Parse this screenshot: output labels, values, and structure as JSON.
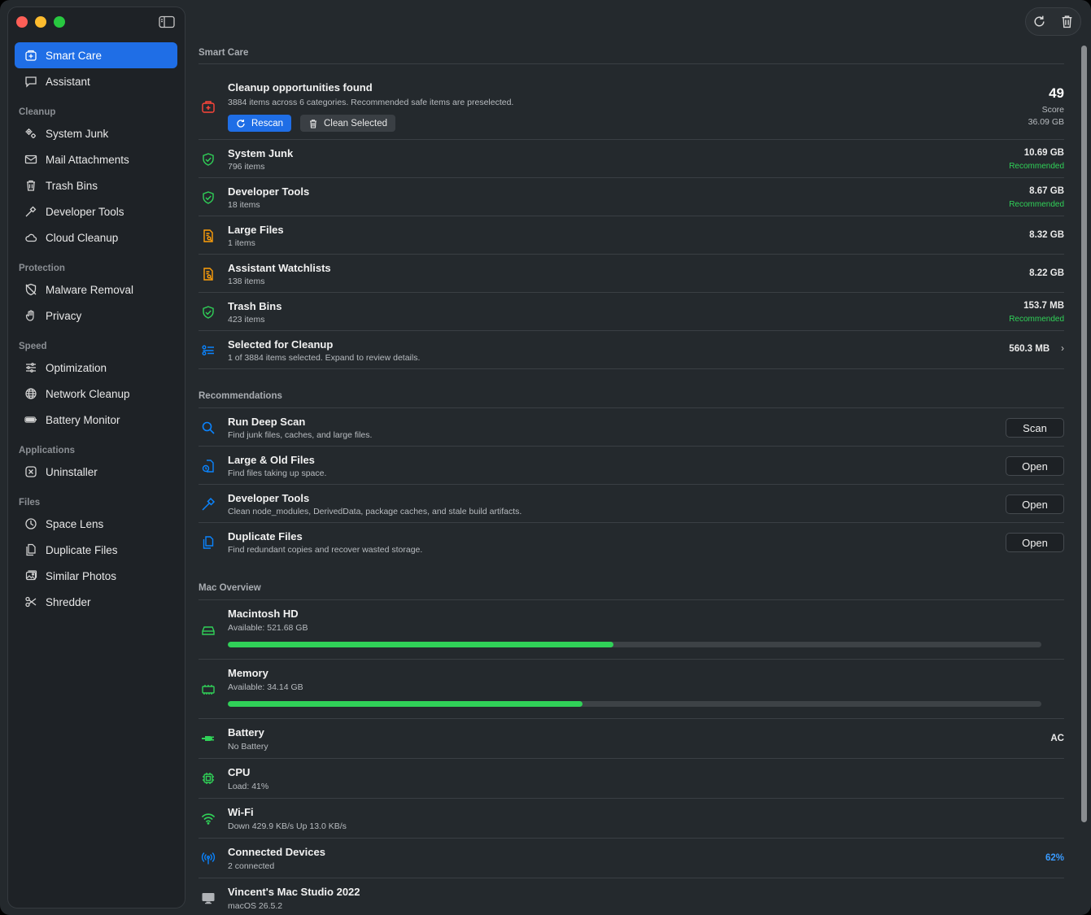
{
  "sidebar": {
    "items": [
      {
        "label": "Smart Care",
        "icon": "smart-care-icon",
        "active": true
      },
      {
        "label": "Assistant",
        "icon": "chat-bubble-icon"
      }
    ],
    "sections": [
      {
        "title": "Cleanup",
        "items": [
          {
            "label": "System Junk",
            "icon": "gears-icon"
          },
          {
            "label": "Mail Attachments",
            "icon": "envelope-icon"
          },
          {
            "label": "Trash Bins",
            "icon": "trash-icon"
          },
          {
            "label": "Developer Tools",
            "icon": "hammer-icon"
          },
          {
            "label": "Cloud Cleanup",
            "icon": "cloud-icon"
          }
        ]
      },
      {
        "title": "Protection",
        "items": [
          {
            "label": "Malware Removal",
            "icon": "shield-slash-icon"
          },
          {
            "label": "Privacy",
            "icon": "hand-icon"
          }
        ]
      },
      {
        "title": "Speed",
        "items": [
          {
            "label": "Optimization",
            "icon": "sliders-icon"
          },
          {
            "label": "Network Cleanup",
            "icon": "globe-icon"
          },
          {
            "label": "Battery Monitor",
            "icon": "battery-icon"
          }
        ]
      },
      {
        "title": "Applications",
        "items": [
          {
            "label": "Uninstaller",
            "icon": "x-square-icon"
          }
        ]
      },
      {
        "title": "Files",
        "items": [
          {
            "label": "Space Lens",
            "icon": "pie-clock-icon"
          },
          {
            "label": "Duplicate Files",
            "icon": "documents-icon"
          },
          {
            "label": "Similar Photos",
            "icon": "photos-icon"
          },
          {
            "label": "Shredder",
            "icon": "scissors-icon"
          }
        ]
      }
    ]
  },
  "smart_care": {
    "heading": "Smart Care",
    "summary": {
      "title": "Cleanup opportunities found",
      "subtitle": "3884 items across 6 categories. Recommended safe items are preselected.",
      "rescan_label": "Rescan",
      "clean_label": "Clean Selected",
      "score": "49",
      "score_label": "Score",
      "total_size": "36.09 GB"
    },
    "categories": [
      {
        "title": "System Junk",
        "sub": "796 items",
        "size": "10.69 GB",
        "tag": "Recommended",
        "icon": "shield-check-icon"
      },
      {
        "title": "Developer Tools",
        "sub": "18 items",
        "size": "8.67 GB",
        "tag": "Recommended",
        "icon": "shield-check-icon"
      },
      {
        "title": "Large Files",
        "sub": "1 items",
        "size": "8.32 GB",
        "tag": "",
        "icon": "doc-search-icon"
      },
      {
        "title": "Assistant Watchlists",
        "sub": "138 items",
        "size": "8.22 GB",
        "tag": "",
        "icon": "doc-search-icon"
      },
      {
        "title": "Trash Bins",
        "sub": "423 items",
        "size": "153.7 MB",
        "tag": "Recommended",
        "icon": "shield-check-icon"
      }
    ],
    "selected": {
      "title": "Selected for Cleanup",
      "sub": "1 of 3884 items selected. Expand to review details.",
      "size": "560.3 MB"
    }
  },
  "recommendations": {
    "heading": "Recommendations",
    "items": [
      {
        "title": "Run Deep Scan",
        "sub": "Find junk files, caches, and large files.",
        "button": "Scan",
        "icon": "magnifier-icon"
      },
      {
        "title": "Large & Old Files",
        "sub": "Find files taking up space.",
        "button": "Open",
        "icon": "doc-clock-icon"
      },
      {
        "title": "Developer Tools",
        "sub": "Clean node_modules, DerivedData, package caches, and stale build artifacts.",
        "button": "Open",
        "icon": "hammer-icon"
      },
      {
        "title": "Duplicate Files",
        "sub": "Find redundant copies and recover wasted storage.",
        "button": "Open",
        "icon": "documents-icon"
      }
    ]
  },
  "overview": {
    "heading": "Mac Overview",
    "disk": {
      "title": "Macintosh HD",
      "sub": "Available: 521.68 GB",
      "used_fraction": 0.474
    },
    "memory": {
      "title": "Memory",
      "sub": "Available: 34.14 GB",
      "used_fraction": 0.436
    },
    "battery": {
      "title": "Battery",
      "sub": "No Battery",
      "value": "AC"
    },
    "cpu": {
      "title": "CPU",
      "sub": "Load: 41%"
    },
    "wifi": {
      "title": "Wi-Fi",
      "sub": "Down 429.9 KB/s  Up 13.0 KB/s"
    },
    "devices": {
      "title": "Connected Devices",
      "sub": "2 connected",
      "value": "62%"
    },
    "mac": {
      "title": "Vincent's Mac Studio 2022",
      "sub": "macOS 26.5.2"
    }
  },
  "colors": {
    "accent": "#1f6ee6",
    "green": "#30d158",
    "orange": "#ff9f0a",
    "red": "#ff453a",
    "blue": "#0a84ff"
  }
}
